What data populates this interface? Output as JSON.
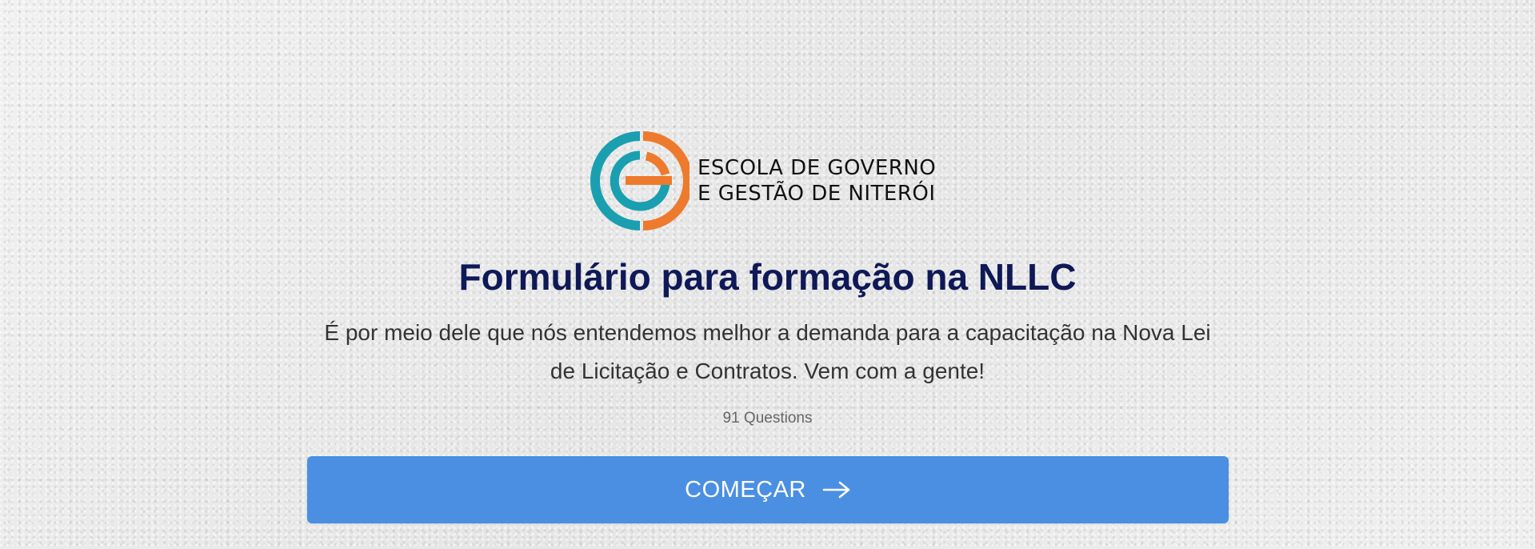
{
  "logo": {
    "line1": "ESCOLA DE GOVERNO",
    "line2": "E GESTÃO DE NITERÓI",
    "colors": {
      "teal": "#1a9fb0",
      "orange": "#ee7a2d"
    }
  },
  "form": {
    "title": "Formulário para formação na NLLC",
    "description": "É por meio dele que nós entendemos melhor a demanda para a capacitação na Nova Lei de Licitação e Contratos. Vem com a gente!",
    "question_count": "91  Questions",
    "start_label": "COMEÇAR",
    "start_icon": "arrow-right-icon"
  },
  "colors": {
    "title": "#0f1957",
    "button": "#4a8fe2",
    "background": "#ececec"
  }
}
